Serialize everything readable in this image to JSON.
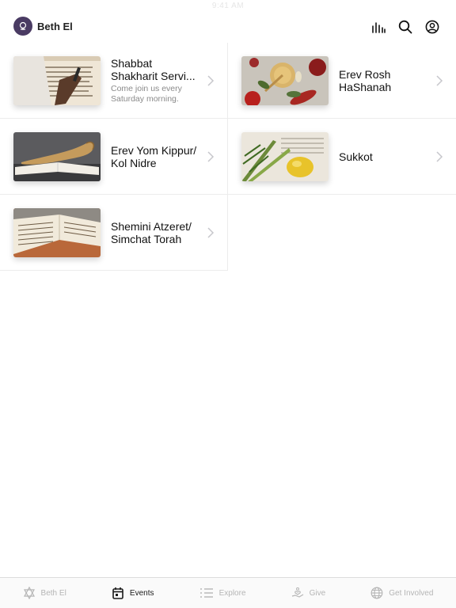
{
  "status_bar": {
    "time": "9:41 AM"
  },
  "header": {
    "brand_name": "Beth El",
    "icons": [
      "chart-bars-icon",
      "search-icon",
      "account-icon"
    ]
  },
  "events": [
    {
      "title": "Shabbat Shakharit Servi...",
      "subtitle": "Come join us every Saturday morning.",
      "image": "torah-scroll-hand"
    },
    {
      "title": "Erev Rosh HaShanah",
      "subtitle": "",
      "image": "apples-honey-pomegranate"
    },
    {
      "title": "Erev Yom Kippur/ Kol Nidre",
      "subtitle": "",
      "image": "shofar-on-book"
    },
    {
      "title": "Sukkot",
      "subtitle": "",
      "image": "lulav-etrog"
    },
    {
      "title": "Shemini Atzeret/ Simchat Torah",
      "subtitle": "",
      "image": "open-torah"
    }
  ],
  "tabbar": {
    "tabs": [
      {
        "label": "Beth El",
        "icon": "star-of-david-icon",
        "active": false
      },
      {
        "label": "Events",
        "icon": "calendar-icon",
        "active": true
      },
      {
        "label": "Explore",
        "icon": "list-icon",
        "active": false
      },
      {
        "label": "Give",
        "icon": "hand-heart-icon",
        "active": false
      },
      {
        "label": "Get Involved",
        "icon": "globe-icon",
        "active": false
      }
    ]
  },
  "colors": {
    "accent": "#4a3b63",
    "inactive": "#b5b5b5",
    "divider": "#ececec"
  }
}
